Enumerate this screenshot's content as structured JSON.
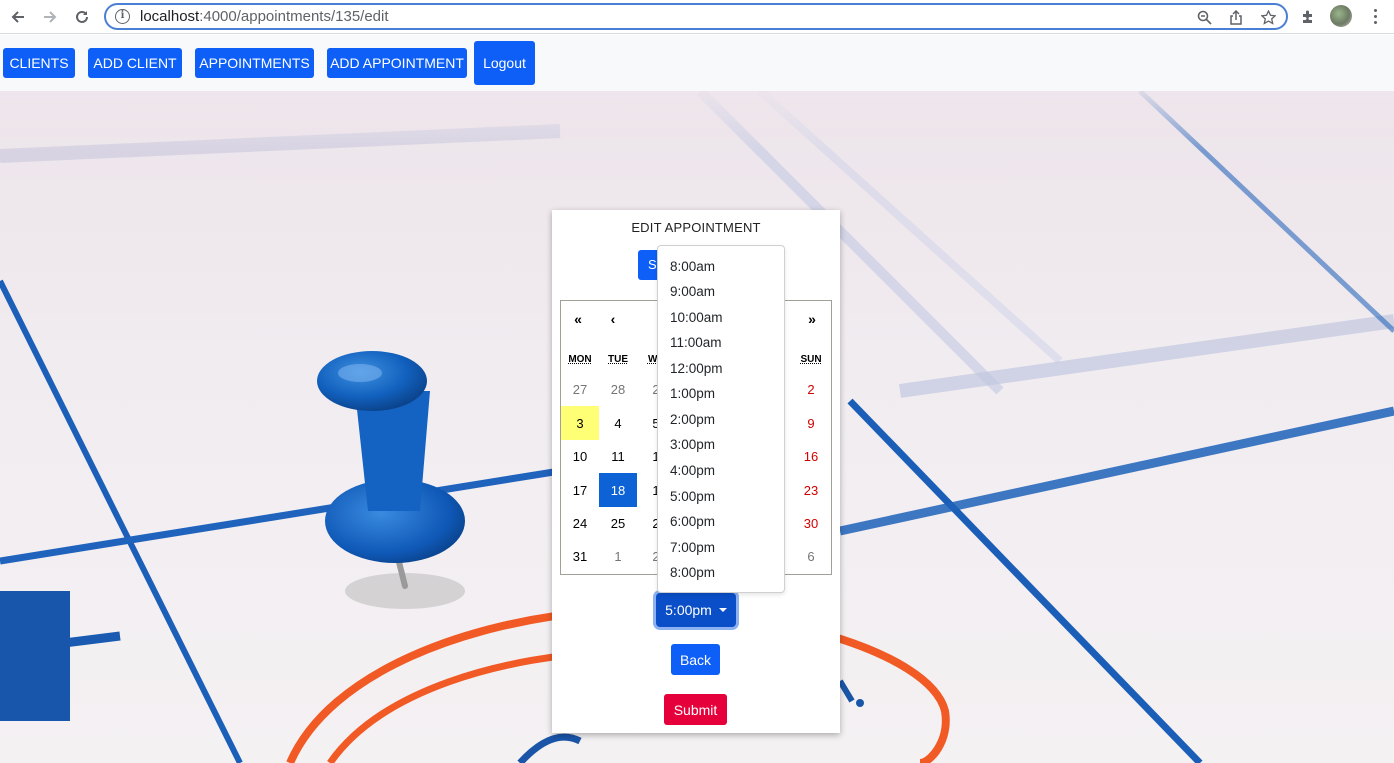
{
  "browser": {
    "url_host": "localhost",
    "url_path": ":4000/appointments/135/edit"
  },
  "nav": {
    "clients": "CLIENTS",
    "add_client": "ADD CLIENT",
    "appointments": "APPOINTMENTS",
    "add_appointment": "ADD APPOINTMENT",
    "logout": "Logout"
  },
  "form": {
    "title": "EDIT APPOINTMENT",
    "save_partial": "S",
    "time_selected": "5:00pm",
    "back": "Back",
    "submit": "Submit"
  },
  "calendar": {
    "nav": {
      "prev_year": "«",
      "prev_month": "‹",
      "next_year": "»"
    },
    "weekdays": [
      "MON",
      "TUE",
      "WE",
      "SUN"
    ],
    "rows": [
      [
        "27",
        "28",
        "2",
        "2"
      ],
      [
        "3",
        "4",
        "5",
        "9"
      ],
      [
        "10",
        "11",
        "1",
        "16"
      ],
      [
        "17",
        "18",
        "1",
        "23"
      ],
      [
        "24",
        "25",
        "2",
        "30"
      ],
      [
        "31",
        "1",
        "2",
        "6"
      ]
    ],
    "today": "3",
    "selected": "18"
  },
  "time_options": [
    "8:00am",
    "9:00am",
    "10:00am",
    "11:00am",
    "12:00pm",
    "1:00pm",
    "2:00pm",
    "3:00pm",
    "4:00pm",
    "5:00pm",
    "6:00pm",
    "7:00pm",
    "8:00pm"
  ],
  "colors": {
    "primary": "#0d5ff8",
    "danger": "#e5003c",
    "weekend": "#d10000",
    "today": "#ffff76",
    "selected_day": "#0d63d6"
  }
}
